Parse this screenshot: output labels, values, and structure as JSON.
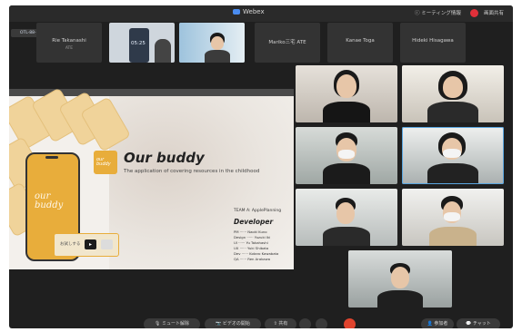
{
  "window": {
    "title": "Webex"
  },
  "header": {
    "meeting_info_label": "ミーティング情報",
    "exit_label": "画面共有",
    "meeting_pill": "OTL-88-HBW88"
  },
  "participants_strip": [
    {
      "name": "Rie Takanashi",
      "sub": "ATE"
    },
    {
      "name": "",
      "sub": "",
      "video": "phone-timer",
      "timer": "05:25"
    },
    {
      "name": "",
      "sub": "",
      "video": "person-with-glasses"
    },
    {
      "name": "Mariko三宅 ATE",
      "sub": ""
    },
    {
      "name": "Kanae Toga",
      "sub": ""
    },
    {
      "name": "Hideki Hisagawa",
      "sub": ""
    }
  ],
  "shared_slide": {
    "app_title": "Our buddy",
    "subtitle": "The application of covering resources in the childhood",
    "badge_text": "our buddy",
    "phone_logo_line1": "our",
    "phone_logo_line2": "buddy",
    "cta_text": "お試しする",
    "cta_button": "▸",
    "team_label": "TEAM A: ApplePlanning",
    "developer_title": "Developer",
    "developers": [
      {
        "role": "PM",
        "name": "Naoki Kuno"
      },
      {
        "role": "Design",
        "name": "Yuzuki Iki"
      },
      {
        "role": "UI",
        "name": "Yu Takahashi"
      },
      {
        "role": "UX",
        "name": "Yuki Shibata"
      },
      {
        "role": "Dev",
        "name": "Kotaro Kawabata"
      },
      {
        "role": "QA",
        "name": "Ren Arakawa"
      }
    ]
  },
  "video_grid": [
    {
      "id": "r1c1",
      "mask": false
    },
    {
      "id": "r1c2",
      "mask": false
    },
    {
      "id": "r2c1",
      "mask": true
    },
    {
      "id": "r2c2",
      "mask": true,
      "active": true
    },
    {
      "id": "r3c1",
      "mask": false
    },
    {
      "id": "r3c2",
      "mask": true
    },
    {
      "id": "r4",
      "mask": false
    }
  ],
  "controls": {
    "mute_label": "ミュート解除",
    "video_label": "ビデオの開始",
    "share_label": "共有",
    "participants_label": "参加者",
    "chat_label": "チャット"
  },
  "colors": {
    "accent": "#e8ad3b",
    "end": "#e0442e",
    "bg": "#1f1f1f"
  }
}
